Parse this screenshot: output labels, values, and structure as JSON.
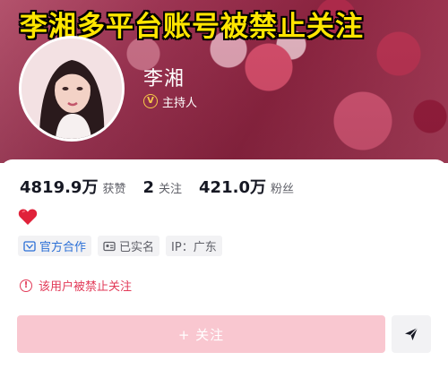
{
  "headline": "李湘多平台账号被禁止关注",
  "profile": {
    "name": "李湘",
    "verified_label": "主持人",
    "verified_icon": "verified-v-icon"
  },
  "stats": [
    {
      "value": "4819.9万",
      "label": "获赞"
    },
    {
      "value": "2",
      "label": "关注"
    },
    {
      "value": "421.0万",
      "label": "粉丝"
    }
  ],
  "bio_emoji": "red-heart-icon",
  "tags": [
    {
      "text": "官方合作",
      "icon": "handshake-icon"
    },
    {
      "text": "已实名",
      "icon": "id-card-icon"
    },
    {
      "text": "IP：广东",
      "icon": ""
    }
  ],
  "ban_notice": "该用户被禁止关注",
  "actions": {
    "follow_label": "+ 关注",
    "share_icon": "send-arrow-icon"
  },
  "colors": {
    "headline": "#ffe600",
    "warning": "#e23a58",
    "follow_button": "#f9c7d0",
    "official_tag": "#2b6fd6"
  }
}
